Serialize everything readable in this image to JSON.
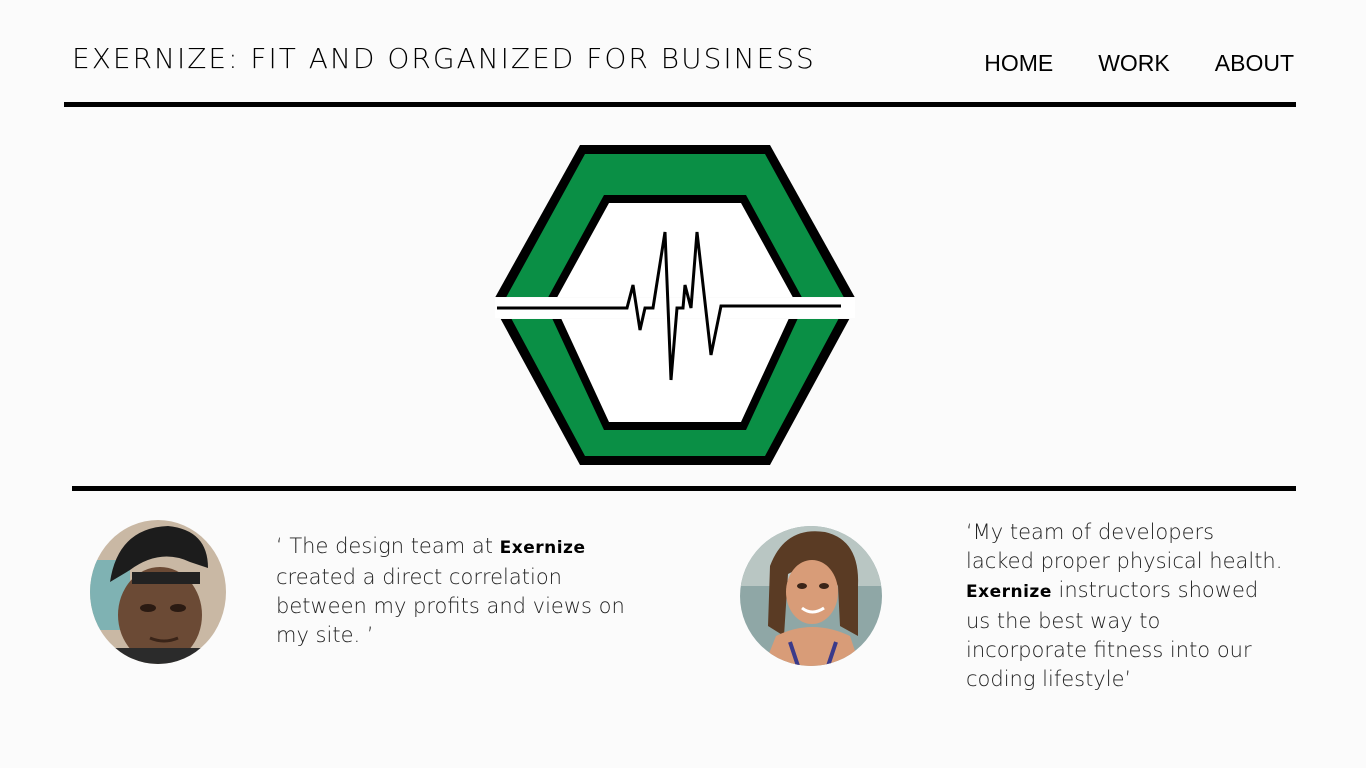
{
  "header": {
    "title": "EXERNIZE: FIT AND ORGANIZED FOR BUSINESS",
    "nav": [
      "HOME",
      "WORK",
      "ABOUT"
    ]
  },
  "logo": {
    "icon": "hexagon-heartbeat-icon",
    "colors": {
      "primary": "#0a8f45",
      "outline": "#000000",
      "inner": "#ffffff"
    }
  },
  "testimonials": [
    {
      "avatar": "man-with-cap-avatar",
      "text_before": "‘ The design team at ",
      "brand": "Exernize",
      "text_after": " created a direct correlation between my profits and views on my site. ’"
    },
    {
      "avatar": "woman-avatar",
      "text_before": "‘My team of developers lacked proper physical health. ",
      "brand": "Exernize",
      "text_after": " instructors showed us the best way to incorporate fitness into our coding lifestyle’"
    }
  ]
}
